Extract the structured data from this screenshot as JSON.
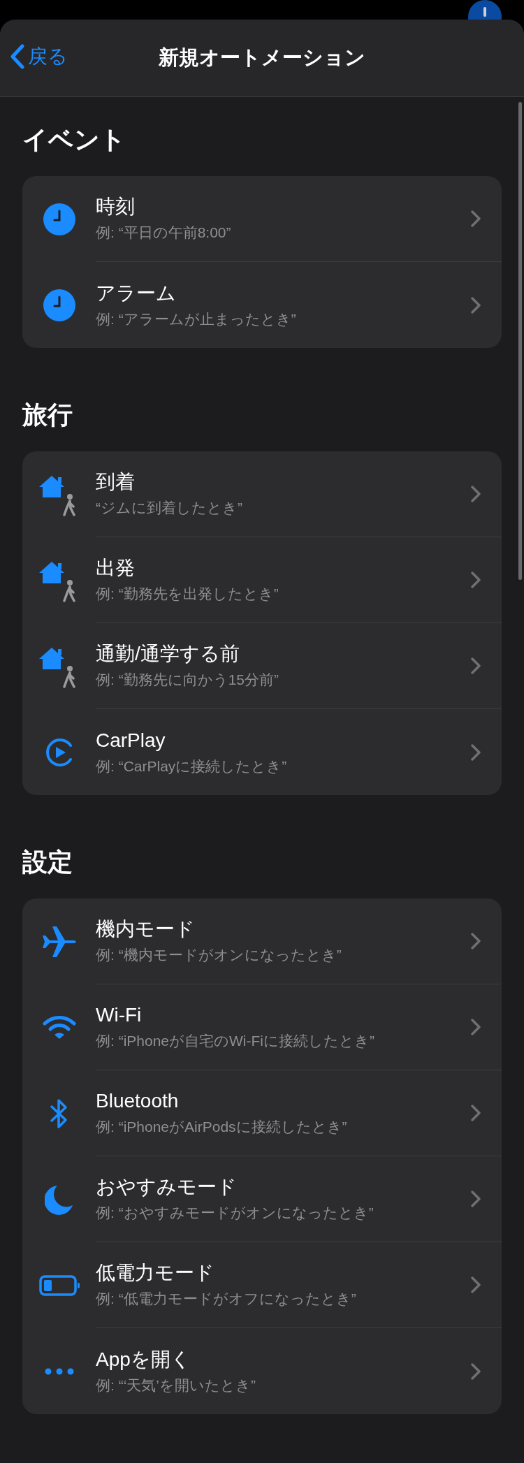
{
  "nav": {
    "back": "戻る",
    "title": "新規オートメーション"
  },
  "sections": [
    {
      "title": "イベント",
      "rows": [
        {
          "kind": "clock",
          "title": "時刻",
          "subtitle": "例: “平日の午前8:00”"
        },
        {
          "kind": "clock",
          "title": "アラーム",
          "subtitle": "例: “アラームが止まったとき”"
        }
      ]
    },
    {
      "title": "旅行",
      "rows": [
        {
          "kind": "home-person",
          "title": "到着",
          "subtitle": "“ジムに到着したとき”"
        },
        {
          "kind": "home-person",
          "title": "出発",
          "subtitle": "例: “勤務先を出発したとき”"
        },
        {
          "kind": "home-person",
          "title": "通勤/通学する前",
          "subtitle": "例: “勤務先に向かう15分前”"
        },
        {
          "kind": "carplay",
          "title": "CarPlay",
          "subtitle": "例: “CarPlayに接続したとき”"
        }
      ]
    },
    {
      "title": "設定",
      "rows": [
        {
          "kind": "airplane",
          "title": "機内モード",
          "subtitle": "例: “機内モードがオンになったとき”"
        },
        {
          "kind": "wifi",
          "title": "Wi-Fi",
          "subtitle": "例: “iPhoneが自宅のWi-Fiに接続したとき”"
        },
        {
          "kind": "bluetooth",
          "title": "Bluetooth",
          "subtitle": "例: “iPhoneがAirPodsに接続したとき”"
        },
        {
          "kind": "moon",
          "title": "おやすみモード",
          "subtitle": "例: “おやすみモードがオンになったとき”"
        },
        {
          "kind": "battery",
          "title": "低電力モード",
          "subtitle": "例: “低電力モードがオフになったとき”"
        },
        {
          "kind": "ellipsis",
          "title": "Appを開く",
          "subtitle": "例: “‘天気’を開いたとき”"
        }
      ]
    }
  ]
}
